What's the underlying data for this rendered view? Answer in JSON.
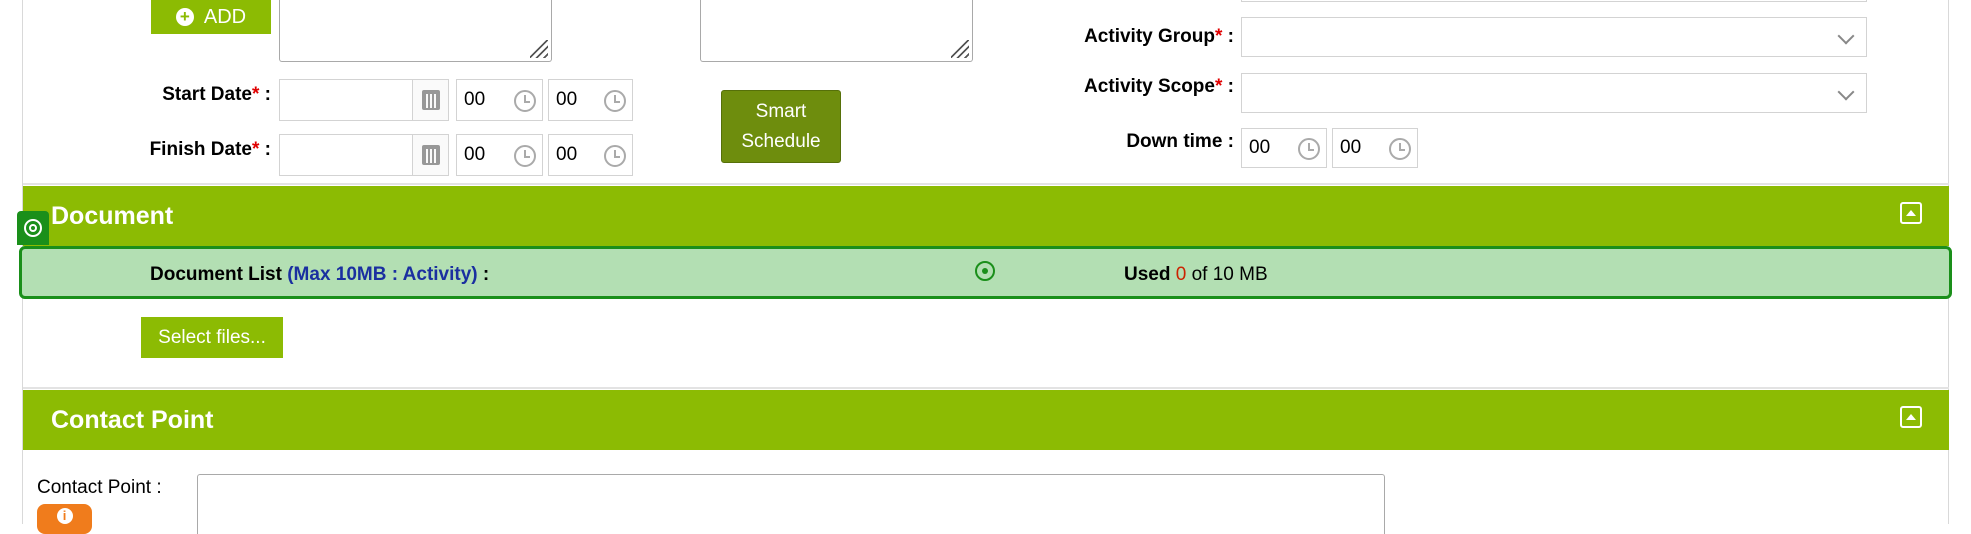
{
  "add_button": {
    "label": "ADD"
  },
  "schedule": {
    "start_date": {
      "label": "Start Date",
      "required": "*",
      "colon": " :",
      "value": "",
      "hour": "00",
      "minute": "00"
    },
    "finish_date": {
      "label": "Finish Date",
      "required": "*",
      "colon": " :",
      "value": "",
      "hour": "00",
      "minute": "00"
    },
    "smart_schedule": {
      "line1": "Smart",
      "line2": "Schedule"
    }
  },
  "activity": {
    "group": {
      "label": "Activity Group",
      "required": "*",
      "colon": " :",
      "value": ""
    },
    "scope": {
      "label": "Activity Scope",
      "required": "*",
      "colon": " :",
      "value": ""
    },
    "down_time": {
      "label": "Down time :",
      "hour": "00",
      "minute": "00"
    }
  },
  "document": {
    "title": "Document",
    "list_label": "Document List",
    "limit_text": "(Max 10MB : Activity)",
    "colon": " :",
    "used_label": "Used",
    "used_value": "0",
    "used_suffix": "of 10 MB",
    "select_files": "Select files..."
  },
  "contact": {
    "title": "Contact Point",
    "label": "Contact Point :",
    "value": ""
  },
  "colors": {
    "band": "#8cbb03",
    "smart_button": "#6e8d0d",
    "highlight_fill": "#b3dfb3",
    "highlight_border": "#1a8f1a",
    "limit_text": "#1a2fa0",
    "used_value": "#cc2200",
    "info_button": "#f07c1c"
  },
  "icons": [
    "plus-circle-icon",
    "calendar-icon",
    "clock-icon",
    "chevron-down-icon",
    "collapse-up-icon",
    "target-icon",
    "crosshair-icon",
    "info-icon",
    "resize-grip-icon"
  ]
}
